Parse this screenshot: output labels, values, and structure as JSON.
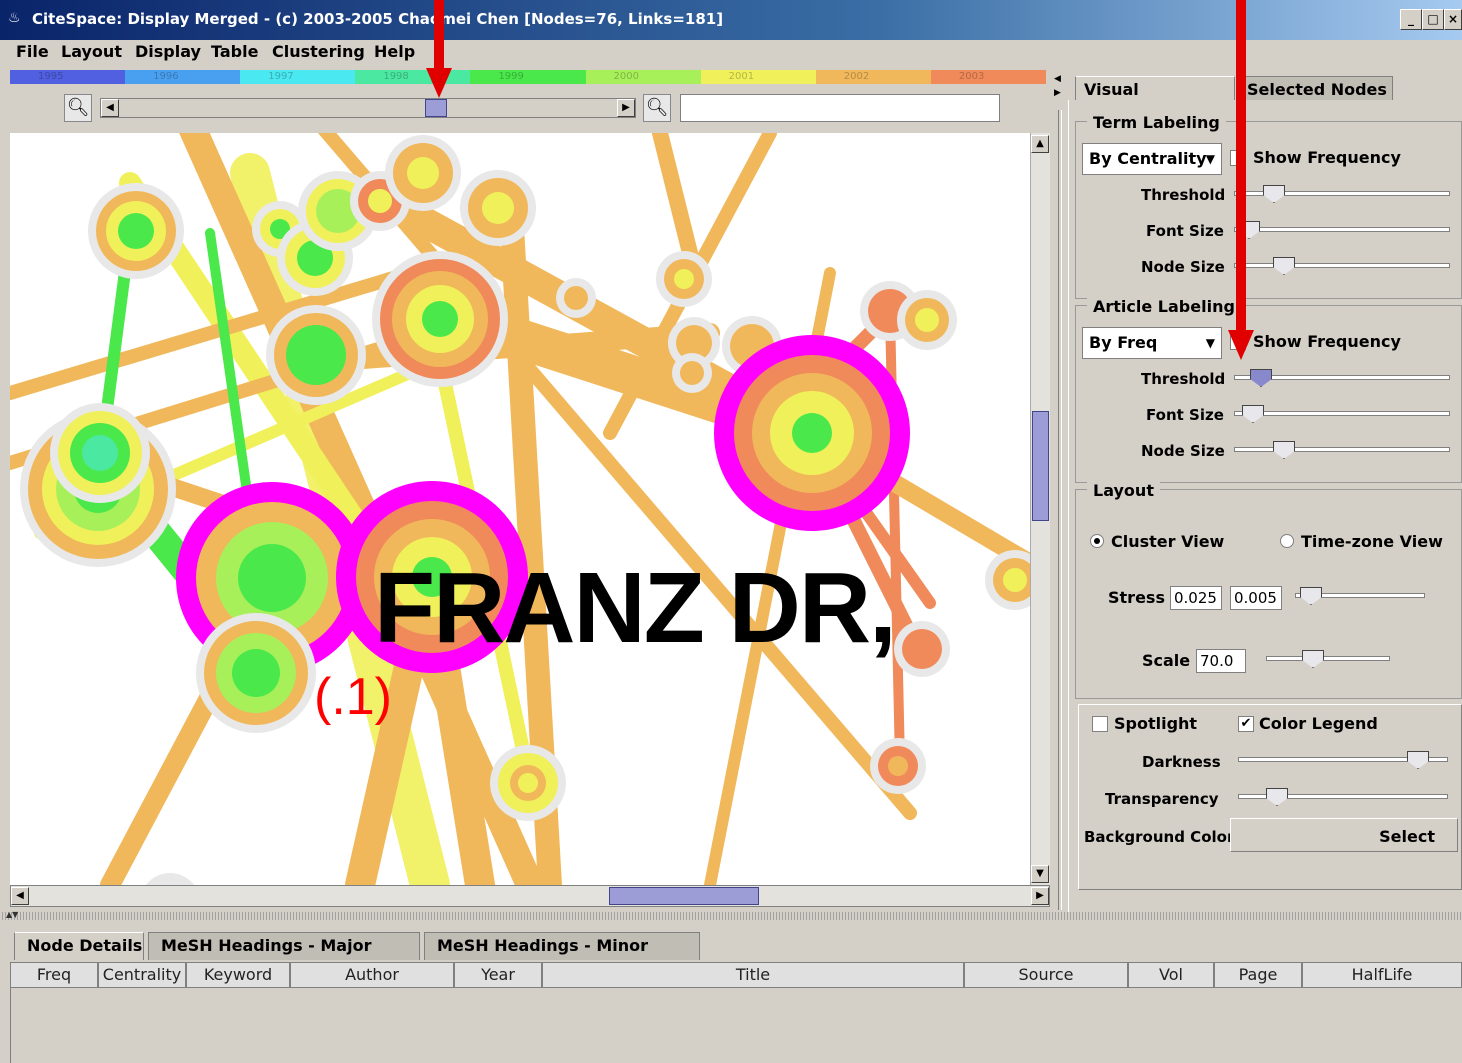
{
  "window": {
    "title": "CiteSpace: Display Merged - (c) 2003-2005 Chaomei Chen [Nodes=76, Links=181]",
    "minimize": "_",
    "maximize": "□",
    "close": "×"
  },
  "menu": [
    "File",
    "Layout",
    "Display",
    "Table",
    "Clustering",
    "Help"
  ],
  "timeline": {
    "years": [
      "1995",
      "1996",
      "1997",
      "1998",
      "1999",
      "2000",
      "2001",
      "2002",
      "2003"
    ],
    "colors": [
      "#5060e0",
      "#4aa0f0",
      "#4ae8f0",
      "#4ae8a0",
      "#4ae84a",
      "#a8f05a",
      "#f0f05a",
      "#f0b85a",
      "#f08a5a"
    ]
  },
  "search": {
    "value": ""
  },
  "canvas": {
    "label": "FRANZ DR,",
    "frequency": "(.1)"
  },
  "tabs": {
    "visual": "Visual Attributes",
    "selected": "Selected Nodes"
  },
  "term_labeling": {
    "title": "Term Labeling",
    "mode": "By Centrality",
    "show_frequency": "Show Frequency",
    "show_frequency_checked": false,
    "threshold": "Threshold",
    "font_size": "Font Size",
    "node_size": "Node Size",
    "threshold_level": 0.15,
    "font_size_level": 0.02,
    "node_size_level": 0.2
  },
  "article_labeling": {
    "title": "Article Labeling",
    "mode": "By Freq",
    "show_frequency": "Show Frequency",
    "show_frequency_checked": false,
    "threshold": "Threshold",
    "font_size": "Font Size",
    "node_size": "Node Size",
    "threshold_level": 0.08,
    "font_size_level": 0.04,
    "node_size_level": 0.2
  },
  "layout": {
    "title": "Layout",
    "cluster_view": "Cluster View",
    "timezone_view": "Time-zone View",
    "selected_view": "Cluster View",
    "stress_label": "Stress",
    "stress_a": "0.025",
    "stress_b": "0.005",
    "scale_label": "Scale",
    "scale": "70.0",
    "stress_level": 0.05,
    "scale_level": 0.35
  },
  "display": {
    "spotlight": "Spotlight",
    "spotlight_checked": false,
    "color_legend": "Color Legend",
    "color_legend_checked": true,
    "darkness": "Darkness",
    "transparency": "Transparency",
    "background_color": "Background Color",
    "select": "Select",
    "darkness_level": 0.9,
    "transparency_level": 0.15
  },
  "bottom_tabs": [
    "Node Details",
    "MeSH Headings - Major Topics",
    "MeSH Headings - Minor Topics"
  ],
  "columns": [
    "Freq",
    "Centrality",
    "Keyword",
    "Author",
    "Year",
    "Title",
    "Source",
    "Vol",
    "Page",
    "HalfLife"
  ],
  "colors": {
    "highlight": "#ff00ff",
    "annotation": "#e00000",
    "label_red": "#ff0000"
  }
}
